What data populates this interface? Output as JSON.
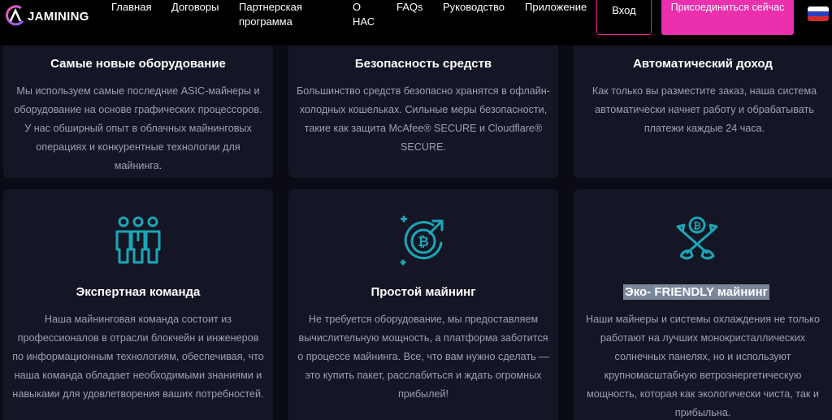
{
  "header": {
    "logo_text": "JAMINING",
    "nav": [
      {
        "label": "Главная"
      },
      {
        "label": "Договоры"
      },
      {
        "label": "Партнерская программа"
      },
      {
        "label": "О НАС"
      },
      {
        "label": "FAQs"
      },
      {
        "label": "Руководство"
      },
      {
        "label": "Приложение"
      }
    ],
    "login_label": "Вход",
    "join_label": "Присоединиться сейчас",
    "language_flag": "russia-flag"
  },
  "features": [
    {
      "title": "Самые новые оборудование",
      "text": "Мы используем самые последние ASIC-майнеры и оборудование на основе графических процессоров. У нас обширный опыт в облачных майнинговых операциях и конкурентные технологии для майнинга."
    },
    {
      "title": "Безопасность средств",
      "text": "Большинство средств безопасно хранятся в офлайн-холодных кошельках. Сильные меры безопасности, такие как защита McAfee® SECURE и Cloudflare® SECURE."
    },
    {
      "title": "Автоматический доход",
      "text": "Как только вы разместите заказ, наша система автоматически начнет работу и обрабатывать платежи каждые 24 часа."
    },
    {
      "title": "Экспертная команда",
      "icon": "team-icon",
      "text": "Наша майнинговая команда состоит из профессионалов в отрасли блокчейн и инженеров по информационным технологиям, обеспечивая, что наша команда обладает необходимыми знаниями и навыками для удовлетворения ваших потребностей."
    },
    {
      "title": "Простой майнинг",
      "icon": "bitcoin-growth-icon",
      "text": "Не требуется оборудование, мы предоставляем вычислительную мощность, а платформа заботится о процессе майнинга. Все, что вам нужно сделать — это купить пакет, расслабиться и ждать огромных прибылей!"
    },
    {
      "title": "Эко- FRIENDLY майнинг",
      "icon": "bitcoin-shovels-icon",
      "text": "Наши майнеры и системы охлаждения не только работают на лучших монокристаллических солнечных панелях, но и используют крупномасштабную ветроэнергетическую мощность, которая как экологически чиста, так и прибыльна."
    }
  ],
  "colors": {
    "accent": "#ea30ad",
    "icon": "#1aa6b7",
    "card_bg": "#151625",
    "page_bg": "#0b0b16"
  }
}
